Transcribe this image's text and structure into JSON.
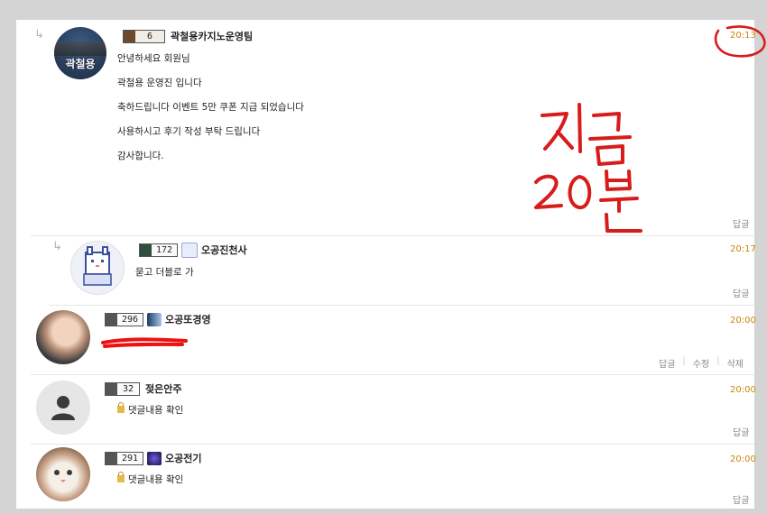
{
  "comments": [
    {
      "nickname": "곽철용카지노운영팀",
      "level": "6",
      "time": "20:13",
      "lines": [
        "안녕하세요 회원님",
        "곽철용 운영진 입니다",
        "축하드립니다 이벤트 5만 쿠폰 지급 되었습니다",
        "사용하시고 후기 작성 부탁 드립니다",
        "감사합니다."
      ],
      "avatar_text": "곽철용",
      "reply_label": "답글"
    },
    {
      "nickname": "오공진천사",
      "level": "172",
      "time": "20:17",
      "lines": [
        "묻고 더블로 가"
      ],
      "reply_label": "답글"
    },
    {
      "nickname": "오공또경영",
      "level": "296",
      "time": "20:00",
      "reply_label": "답글",
      "edit_label": "수정",
      "delete_label": "삭제"
    },
    {
      "nickname": "젖은안주",
      "level": "32",
      "time": "20:00",
      "secret_text": "댓글내용 확인",
      "reply_label": "답글"
    },
    {
      "nickname": "오공전기",
      "level": "291",
      "time": "20:00",
      "secret_text": "댓글내용 확인",
      "reply_label": "답글"
    }
  ],
  "handwriting": {
    "line1": "지금",
    "line2": "20분",
    "color": "#d81c1c"
  },
  "colors": {
    "time": "#c9860a",
    "background": "#d4d4d4"
  }
}
